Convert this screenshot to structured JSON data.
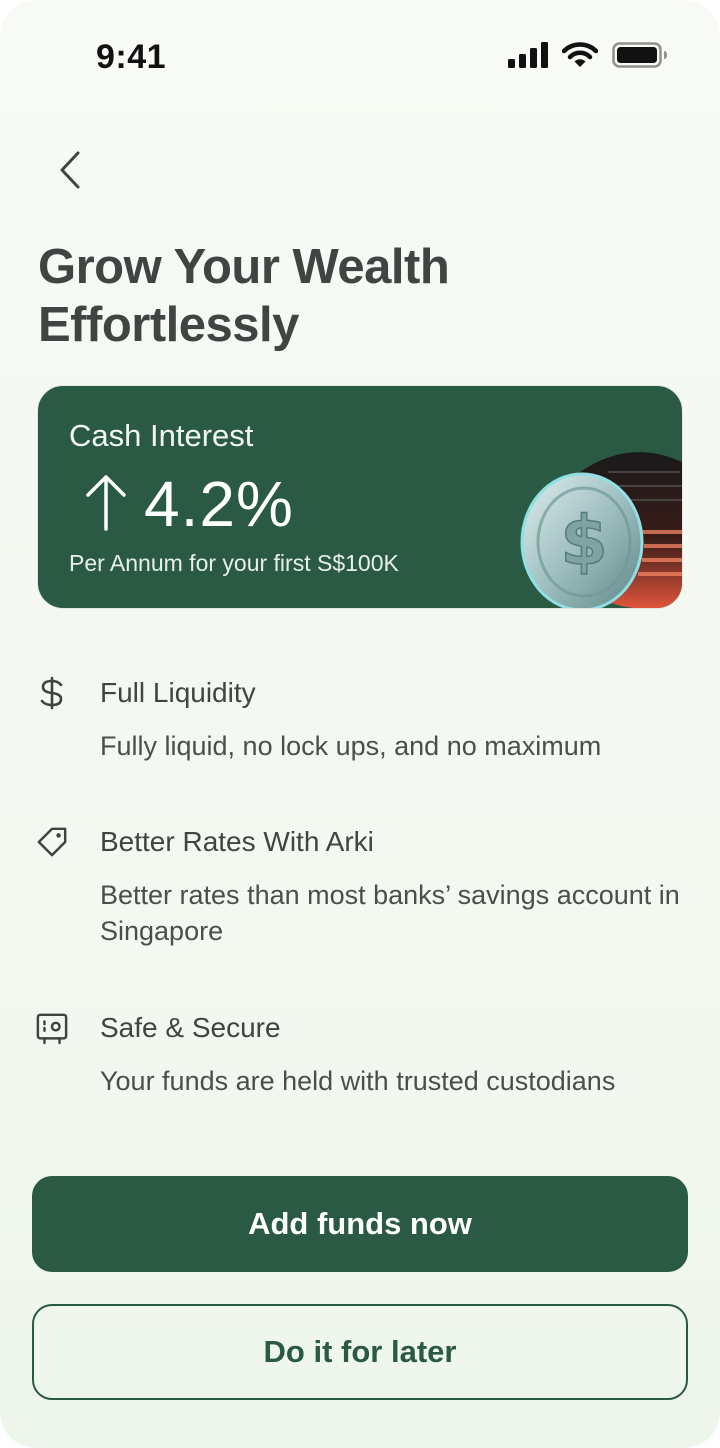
{
  "status_bar": {
    "time": "9:41",
    "icons": [
      "cellular-signal-icon",
      "wifi-icon",
      "battery-icon"
    ]
  },
  "header": {
    "back_icon": "chevron-left-icon",
    "title": "Grow Your Wealth Effortlessly"
  },
  "promo": {
    "label": "Cash Interest",
    "rate_icon": "arrow-up-icon",
    "rate": "4.2%",
    "subtitle": "Per Annum for your first S$100K",
    "image": "dollar-coin-3d"
  },
  "features": [
    {
      "icon": "dollar-sign-icon",
      "title": "Full Liquidity",
      "description": "Fully liquid, no lock ups, and no maximum"
    },
    {
      "icon": "tag-icon",
      "title": "Better Rates With Arki",
      "description": "Better rates than most banks’ savings account in Singapore"
    },
    {
      "icon": "safe-icon",
      "title": "Safe & Secure",
      "description": "Your funds are held with trusted custodians"
    }
  ],
  "actions": {
    "primary_label": "Add funds now",
    "secondary_label": "Do it for later"
  },
  "colors": {
    "brand_green": "#2a5a43",
    "title_text": "#404442",
    "background": "#f6f9f3"
  }
}
